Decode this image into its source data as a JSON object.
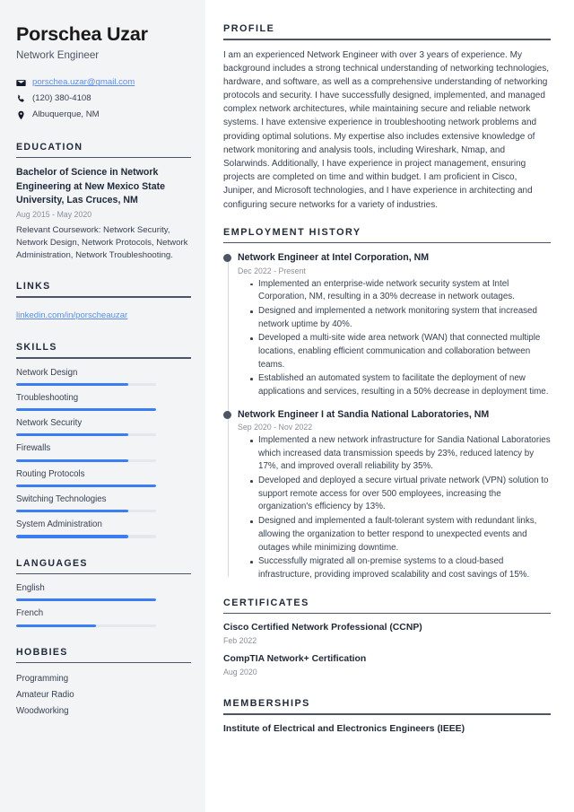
{
  "theme": {
    "accent": "#3b7ef4",
    "link": "#5b8def",
    "sidebar_bg": "#f3f4f6",
    "heading": "#1f2937",
    "body_text": "#374151",
    "muted": "#8b8f98",
    "rule": "#4b5563",
    "timeline_dot": "#4b5563"
  },
  "sidebar": {
    "name": "Porschea Uzar",
    "job_title": "Network Engineer",
    "contact": [
      {
        "icon": "envelope-icon",
        "text": "porschea.uzar@gmail.com",
        "is_link": true
      },
      {
        "icon": "phone-icon",
        "text": "(120) 380-4108",
        "is_link": false
      },
      {
        "icon": "location-pin-icon",
        "text": "Albuquerque, NM",
        "is_link": false
      }
    ],
    "education": {
      "heading": "EDUCATION",
      "degree": "Bachelor of Science in Network Engineering at New Mexico State University, Las Cruces, NM",
      "date": "Aug 2015 - May 2020",
      "description": "Relevant Coursework: Network Security, Network Design, Network Protocols, Network Administration, Network Troubleshooting."
    },
    "links": {
      "heading": "LINKS",
      "items": [
        {
          "label": "linkedin.com/in/porscheauzar"
        }
      ]
    },
    "skills": {
      "heading": "SKILLS",
      "items": [
        {
          "label": "Network Design",
          "level": 80
        },
        {
          "label": "Troubleshooting",
          "level": 100
        },
        {
          "label": "Network Security",
          "level": 80
        },
        {
          "label": "Firewalls",
          "level": 80
        },
        {
          "label": "Routing Protocols",
          "level": 100
        },
        {
          "label": "Switching Technologies",
          "level": 80
        },
        {
          "label": "System Administration",
          "level": 80
        }
      ]
    },
    "languages": {
      "heading": "LANGUAGES",
      "items": [
        {
          "label": "English",
          "level": 100
        },
        {
          "label": "French",
          "level": 57
        }
      ]
    },
    "hobbies": {
      "heading": "HOBBIES",
      "items": [
        {
          "label": "Programming"
        },
        {
          "label": "Amateur Radio"
        },
        {
          "label": "Woodworking"
        }
      ]
    }
  },
  "main": {
    "profile": {
      "heading": "PROFILE",
      "text": "I am an experienced Network Engineer with over 3 years of experience. My background includes a strong technical understanding of networking technologies, hardware, and software, as well as a comprehensive understanding of networking protocols and security. I have successfully designed, implemented, and managed complex network architectures, while maintaining secure and reliable network systems. I have extensive experience in troubleshooting network problems and providing optimal solutions. My expertise also includes extensive knowledge of network monitoring and analysis tools, including Wireshark, Nmap, and Solarwinds. Additionally, I have experience in project management, ensuring projects are completed on time and within budget. I am proficient in Cisco, Juniper, and Microsoft technologies, and I have experience in architecting and configuring secure networks for a variety of industries."
    },
    "employment": {
      "heading": "EMPLOYMENT HISTORY",
      "jobs": [
        {
          "title": "Network Engineer at Intel Corporation, NM",
          "date": "Dec 2022 - Present",
          "bullets": [
            "Implemented an enterprise-wide network security system at Intel Corporation, NM, resulting in a 30% decrease in network outages.",
            "Designed and implemented a network monitoring system that increased network uptime by 40%.",
            "Developed a multi-site wide area network (WAN) that connected multiple locations, enabling efficient communication and collaboration between teams.",
            "Established an automated system to facilitate the deployment of new applications and services, resulting in a 50% decrease in deployment time."
          ]
        },
        {
          "title": "Network Engineer I at Sandia National Laboratories, NM",
          "date": "Sep 2020 - Nov 2022",
          "bullets": [
            "Implemented a new network infrastructure for Sandia National Laboratories which increased data transmission speeds by 23%, reduced latency by 17%, and improved overall reliability by 35%.",
            "Developed and deployed a secure virtual private network (VPN) solution to support remote access for over 500 employees, increasing the organization's efficiency by 13%.",
            "Designed and implemented a fault-tolerant system with redundant links, allowing the organization to better respond to unexpected events and outages while minimizing downtime.",
            "Successfully migrated all on-premise systems to a cloud-based infrastructure, providing improved scalability and cost savings of 15%."
          ]
        }
      ]
    },
    "certificates": {
      "heading": "CERTIFICATES",
      "items": [
        {
          "name": "Cisco Certified Network Professional (CCNP)",
          "date": "Feb 2022"
        },
        {
          "name": "CompTIA Network+ Certification",
          "date": "Aug 2020"
        }
      ]
    },
    "memberships": {
      "heading": "MEMBERSHIPS",
      "items": [
        {
          "name": "Institute of Electrical and Electronics Engineers (IEEE)"
        }
      ]
    }
  }
}
